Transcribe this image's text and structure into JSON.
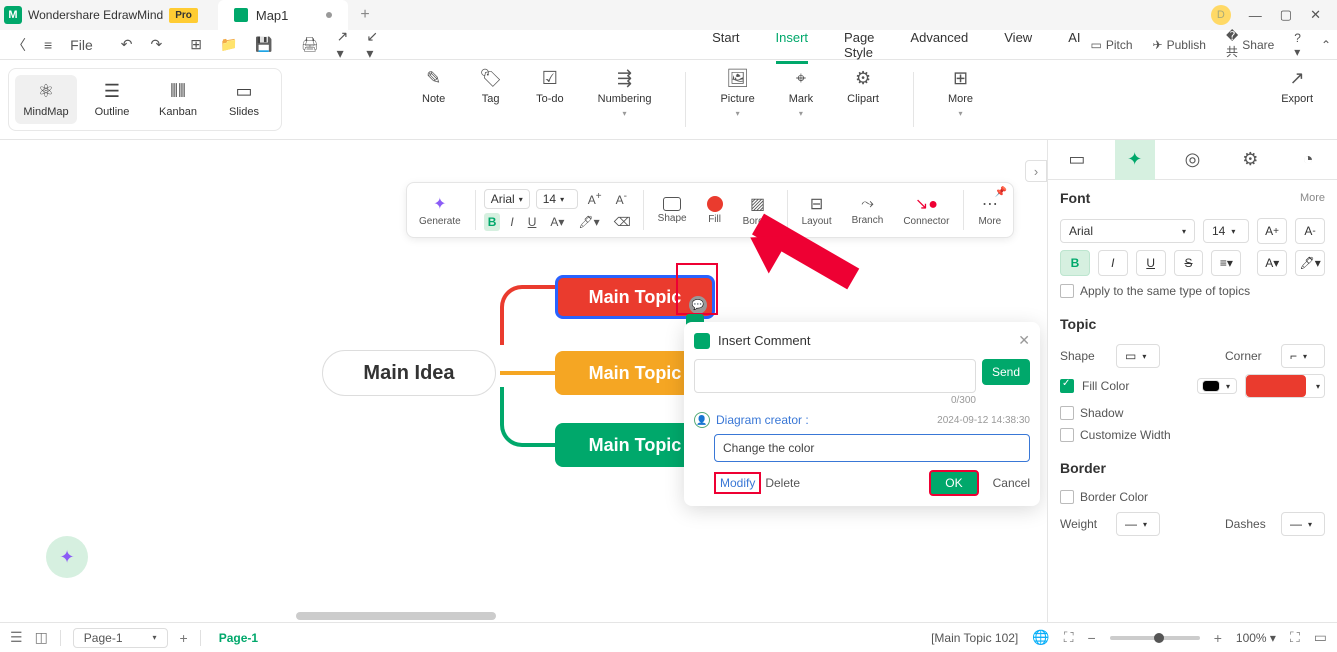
{
  "titlebar": {
    "app_name": "Wondershare EdrawMind",
    "pro_badge": "Pro",
    "tab_name": "Map1",
    "avatar_letter": "D"
  },
  "toolbar": {
    "file_label": "File"
  },
  "menu": {
    "tabs": [
      "Start",
      "Insert",
      "Page Style",
      "Advanced",
      "View",
      "AI"
    ],
    "active_index": 1,
    "right": {
      "pitch": "Pitch",
      "publish": "Publish",
      "share": "Share"
    }
  },
  "viewmodes": {
    "mindmap": "MindMap",
    "outline": "Outline",
    "kanban": "Kanban",
    "slides": "Slides"
  },
  "ribbon": {
    "note": "Note",
    "tag": "Tag",
    "todo": "To-do",
    "numbering": "Numbering",
    "picture": "Picture",
    "mark": "Mark",
    "clipart": "Clipart",
    "more": "More",
    "export": "Export"
  },
  "float_toolbar": {
    "generate": "Generate",
    "font_family": "Arial",
    "font_size": "14",
    "shape": "Shape",
    "fill": "Fill",
    "border": "Border",
    "layout": "Layout",
    "branch": "Branch",
    "connector": "Connector",
    "more": "More"
  },
  "mindmap": {
    "central": "Main Idea",
    "topic1": "Main Topic",
    "topic2": "Main Topic",
    "topic3": "Main Topic"
  },
  "comment_popup": {
    "title": "Insert Comment",
    "send": "Send",
    "char_count": "0/300",
    "author": "Diagram creator :",
    "timestamp": "2024-09-12 14:38:30",
    "text": "Change the color",
    "modify": "Modify",
    "delete": "Delete",
    "ok": "OK",
    "cancel": "Cancel"
  },
  "right_panel": {
    "font_header": "Font",
    "more": "More",
    "font_family": "Arial",
    "font_size": "14",
    "apply_same": "Apply to the same type of topics",
    "topic_header": "Topic",
    "shape_label": "Shape",
    "corner_label": "Corner",
    "fill_color_label": "Fill Color",
    "shadow_label": "Shadow",
    "customize_width_label": "Customize Width",
    "border_header": "Border",
    "border_color_label": "Border Color",
    "weight_label": "Weight",
    "dashes_label": "Dashes"
  },
  "statusbar": {
    "page_select": "Page-1",
    "page_tab": "Page-1",
    "selection": "[Main Topic 102]",
    "zoom": "100%"
  }
}
